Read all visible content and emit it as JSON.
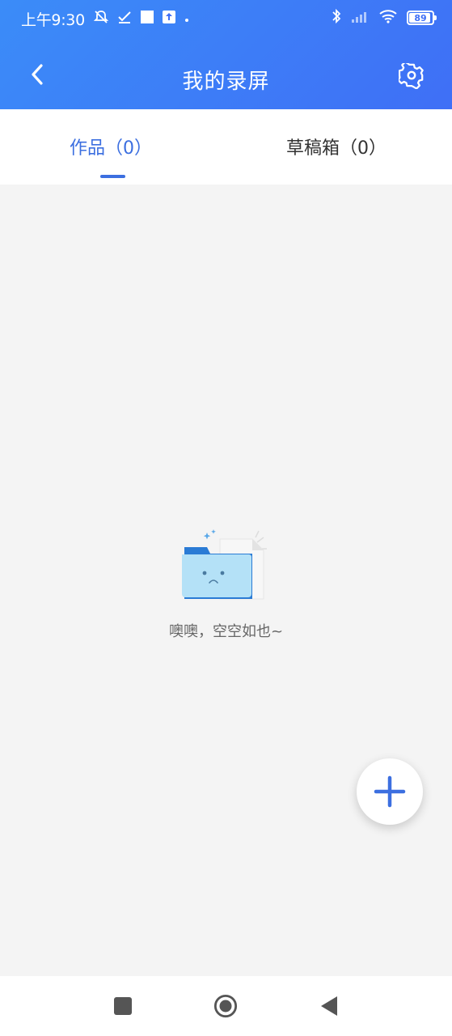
{
  "status_bar": {
    "time": "上午9:30",
    "battery": "89",
    "icons_left": [
      "bell-off-icon",
      "check-icon",
      "square-icon",
      "upload-icon",
      "dot-icon"
    ],
    "icons_right": [
      "bluetooth-icon",
      "signal-icon",
      "wifi-icon",
      "battery-icon"
    ]
  },
  "header": {
    "title": "我的录屏",
    "back_icon": "chevron-left-icon",
    "settings_icon": "gear-icon"
  },
  "tabs": [
    {
      "label": "作品（0）",
      "active": true
    },
    {
      "label": "草稿箱（0）",
      "active": false
    }
  ],
  "empty_state": {
    "illustration": "sad-folder-icon",
    "message": "噢噢，空空如也~"
  },
  "fab": {
    "icon": "plus-icon"
  },
  "system_nav": {
    "items": [
      "recent-apps-icon",
      "home-icon",
      "back-icon"
    ]
  },
  "colors": {
    "header_start": "#3b8cf8",
    "header_end": "#3f6ff6",
    "accent": "#3c6fe0",
    "background": "#f4f4f4"
  }
}
